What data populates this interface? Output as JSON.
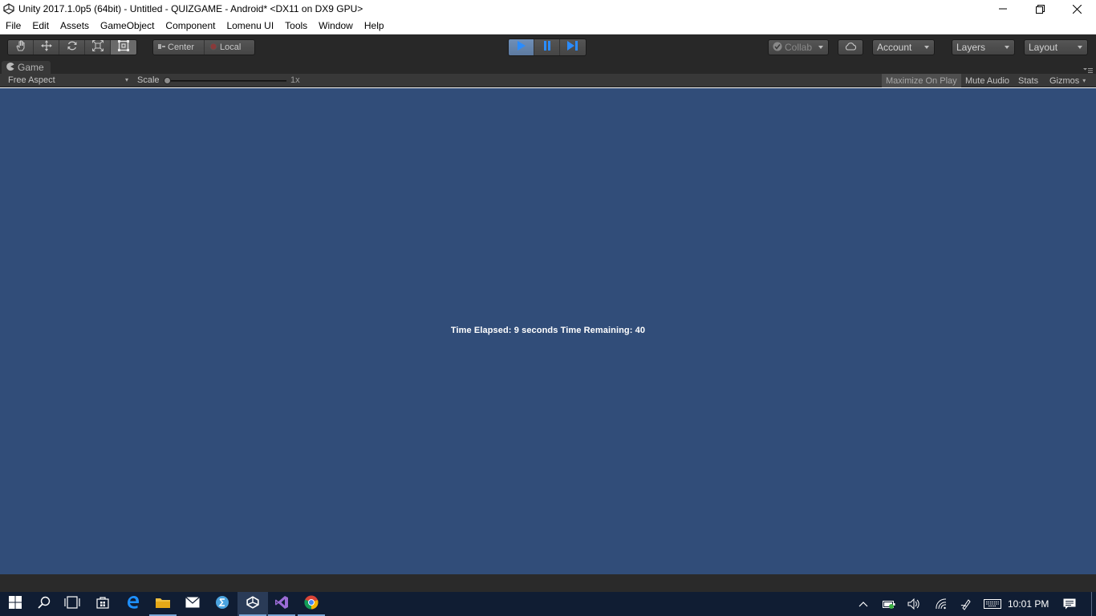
{
  "window": {
    "title": "Unity 2017.1.0p5 (64bit) - Untitled - QUIZGAME - Android* <DX11 on DX9 GPU>"
  },
  "menu": [
    "File",
    "Edit",
    "Assets",
    "GameObject",
    "Component",
    "Lomenu UI",
    "Tools",
    "Window",
    "Help"
  ],
  "toolbar": {
    "pivot_center": "Center",
    "pivot_local": "Local",
    "collab": "Collab",
    "account": "Account",
    "layers": "Layers",
    "layout": "Layout"
  },
  "game_window": {
    "tab_label": "Game",
    "aspect": "Free Aspect",
    "scale_label": "Scale",
    "scale_value": "1x",
    "maximize_on_play": "Maximize On Play",
    "mute_audio": "Mute Audio",
    "stats": "Stats",
    "gizmos": "Gizmos",
    "game_text": "Time Elapsed: 9 seconds Time Remaining: 40",
    "background_color": "#314d79"
  },
  "taskbar": {
    "time": "10:01 PM"
  }
}
